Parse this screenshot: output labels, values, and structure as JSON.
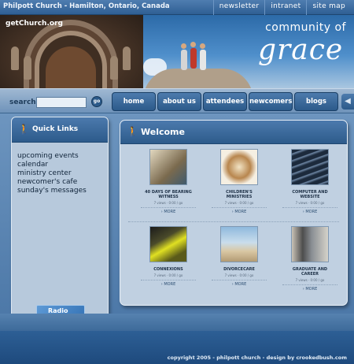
{
  "header": {
    "title": "Philpott Church - Hamilton, Ontario, Canada",
    "links": [
      "newsletter",
      "intranet",
      "site map"
    ]
  },
  "hero": {
    "site_name": "getChurch.org",
    "logo_line1": "community of",
    "logo_line2": "grace"
  },
  "search": {
    "label": "search",
    "placeholder": "",
    "go_label": "go"
  },
  "nav": {
    "tabs": [
      "home",
      "about us",
      "attendees",
      "newcomers",
      "blogs"
    ]
  },
  "sidebar": {
    "title": "Quick Links",
    "links": [
      "upcoming events",
      "calendar",
      "ministry center",
      "newcomer's cafe",
      "sunday's messages"
    ],
    "radio_label": "Radio"
  },
  "main": {
    "title": "Welcome",
    "tiles": [
      {
        "title": "40 DAYS OF BEARING\nWITNESS",
        "meta": "7 views · 0:00 / go",
        "more": "› MORE"
      },
      {
        "title": "CHILDREN'S\nMINISTRIES",
        "meta": "7 views · 0:00 / go",
        "more": "› MORE"
      },
      {
        "title": "COMPUTER AND\nWEBSITE",
        "meta": "7 views · 0:00 / go",
        "more": "› MORE"
      },
      {
        "title": "CONNEXIONS",
        "meta": "7 views · 0:00 / go",
        "more": "› MORE"
      },
      {
        "title": "DIVORCECARE",
        "meta": "7 views · 0:00 / go",
        "more": "› MORE"
      },
      {
        "title": "GRADUATE AND\nCAREER",
        "meta": "7 views · 0:00 / go",
        "more": "› MORE"
      }
    ]
  },
  "footer": {
    "copyright": "copyright 2005 - philpott church - design by crookedbush.com"
  },
  "colors": {
    "brand_blue": "#2d5b8b",
    "panel": "#c0d0e1",
    "sidebar": "#b7c9dc"
  }
}
